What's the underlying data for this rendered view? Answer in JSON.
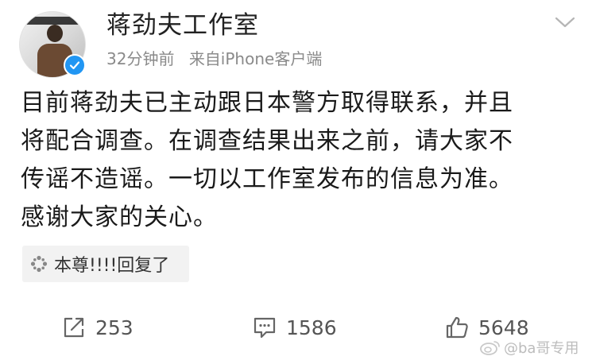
{
  "post": {
    "user_name": "蒋劲夫工作室",
    "time": "32分钟前",
    "source": "来自iPhone客户端",
    "content_lines": [
      "目前蒋劲夫已主动跟日本警方取得联系，并且",
      "将配合调查。在调查结果出来之前，请大家不",
      "传谣不造谣。一切以工作室发布的信息为准。",
      "感谢大家的关心。"
    ],
    "reply_chip": "本尊!!!!回复了",
    "actions": {
      "repost_count": "253",
      "comment_count": "1586",
      "like_count": "5648"
    },
    "watermark": "@ba哥专用"
  },
  "colors": {
    "verified": "#2196f3",
    "meta_text": "#8a8a8a",
    "chip_bg": "#f2f2f2"
  },
  "icons": [
    "verified-badge-icon",
    "chevron-down-icon",
    "sparkle-icon",
    "repost-icon",
    "comment-icon",
    "like-icon",
    "weibo-logo-icon"
  ]
}
